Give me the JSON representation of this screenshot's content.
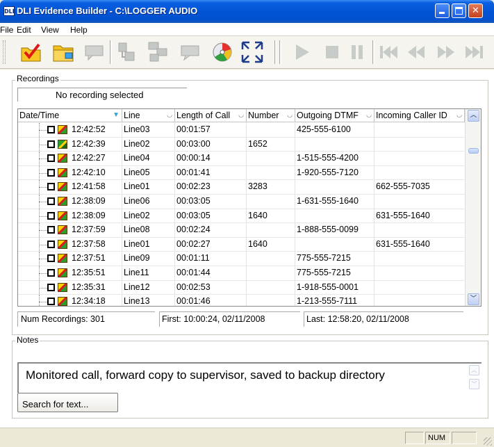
{
  "window": {
    "app_icon_text": "DLI",
    "title": "DLI Evidence Builder - C:\\LOGGER AUDIO"
  },
  "menu": [
    "File",
    "Edit",
    "View",
    "Help"
  ],
  "toolbar": {
    "buttons": [
      "checkmark-folder-icon",
      "open-folder-icon",
      "comment-icon",
      "export-icon",
      "merge-icon",
      "note-icon",
      "burn-disc-icon",
      "fullscreen-icon"
    ],
    "playback": [
      "play-icon",
      "stop-icon",
      "pause-icon",
      "skip-start-icon",
      "rewind-icon",
      "fast-forward-icon",
      "skip-end-icon"
    ]
  },
  "recordings": {
    "group_label": "Recordings",
    "selection_status": "No recording selected",
    "columns": [
      "Date/Time",
      "Line",
      "Length of Call",
      "Number",
      "Outgoing DTMF",
      "Incoming Caller ID"
    ],
    "rows": [
      {
        "time": "12:42:52",
        "line": "Line03",
        "length": "00:01:57",
        "number": "",
        "dtmf": "425-555-6100",
        "caller_id": ""
      },
      {
        "time": "12:42:39",
        "line": "Line02",
        "length": "00:03:00",
        "number": "1652",
        "dtmf": "",
        "caller_id": ""
      },
      {
        "time": "12:42:27",
        "line": "Line04",
        "length": "00:00:14",
        "number": "",
        "dtmf": "1-515-555-4200",
        "caller_id": ""
      },
      {
        "time": "12:42:10",
        "line": "Line05",
        "length": "00:01:41",
        "number": "",
        "dtmf": "1-920-555-7120",
        "caller_id": ""
      },
      {
        "time": "12:41:58",
        "line": "Line01",
        "length": "00:02:23",
        "number": "3283",
        "dtmf": "",
        "caller_id": "662-555-7035"
      },
      {
        "time": "12:38:09",
        "line": "Line06",
        "length": "00:03:05",
        "number": "",
        "dtmf": "1-631-555-1640",
        "caller_id": ""
      },
      {
        "time": "12:38:09",
        "line": "Line02",
        "length": "00:03:05",
        "number": "1640",
        "dtmf": "",
        "caller_id": "631-555-1640"
      },
      {
        "time": "12:37:59",
        "line": "Line08",
        "length": "00:02:24",
        "number": "",
        "dtmf": "1-888-555-0099",
        "caller_id": ""
      },
      {
        "time": "12:37:58",
        "line": "Line01",
        "length": "00:02:27",
        "number": "1640",
        "dtmf": "",
        "caller_id": "631-555-1640"
      },
      {
        "time": "12:37:51",
        "line": "Line09",
        "length": "00:01:11",
        "number": "",
        "dtmf": "775-555-7215",
        "caller_id": ""
      },
      {
        "time": "12:35:51",
        "line": "Line11",
        "length": "00:01:44",
        "number": "",
        "dtmf": "775-555-7215",
        "caller_id": ""
      },
      {
        "time": "12:35:31",
        "line": "Line12",
        "length": "00:02:53",
        "number": "",
        "dtmf": "1-918-555-0001",
        "caller_id": ""
      },
      {
        "time": "12:34:18",
        "line": "Line13",
        "length": "00:01:46",
        "number": "",
        "dtmf": "1-213-555-7111",
        "caller_id": ""
      }
    ],
    "num_recordings": "Num Recordings: 301",
    "first": "First: 10:00:24, 02/11/2008",
    "last": "Last: 12:58:20, 02/11/2008"
  },
  "notes": {
    "group_label": "Notes",
    "text": "Monitored call, forward copy to supervisor, saved to backup directory",
    "search_button": "Search for text..."
  },
  "statusbar": {
    "num": "NUM"
  }
}
